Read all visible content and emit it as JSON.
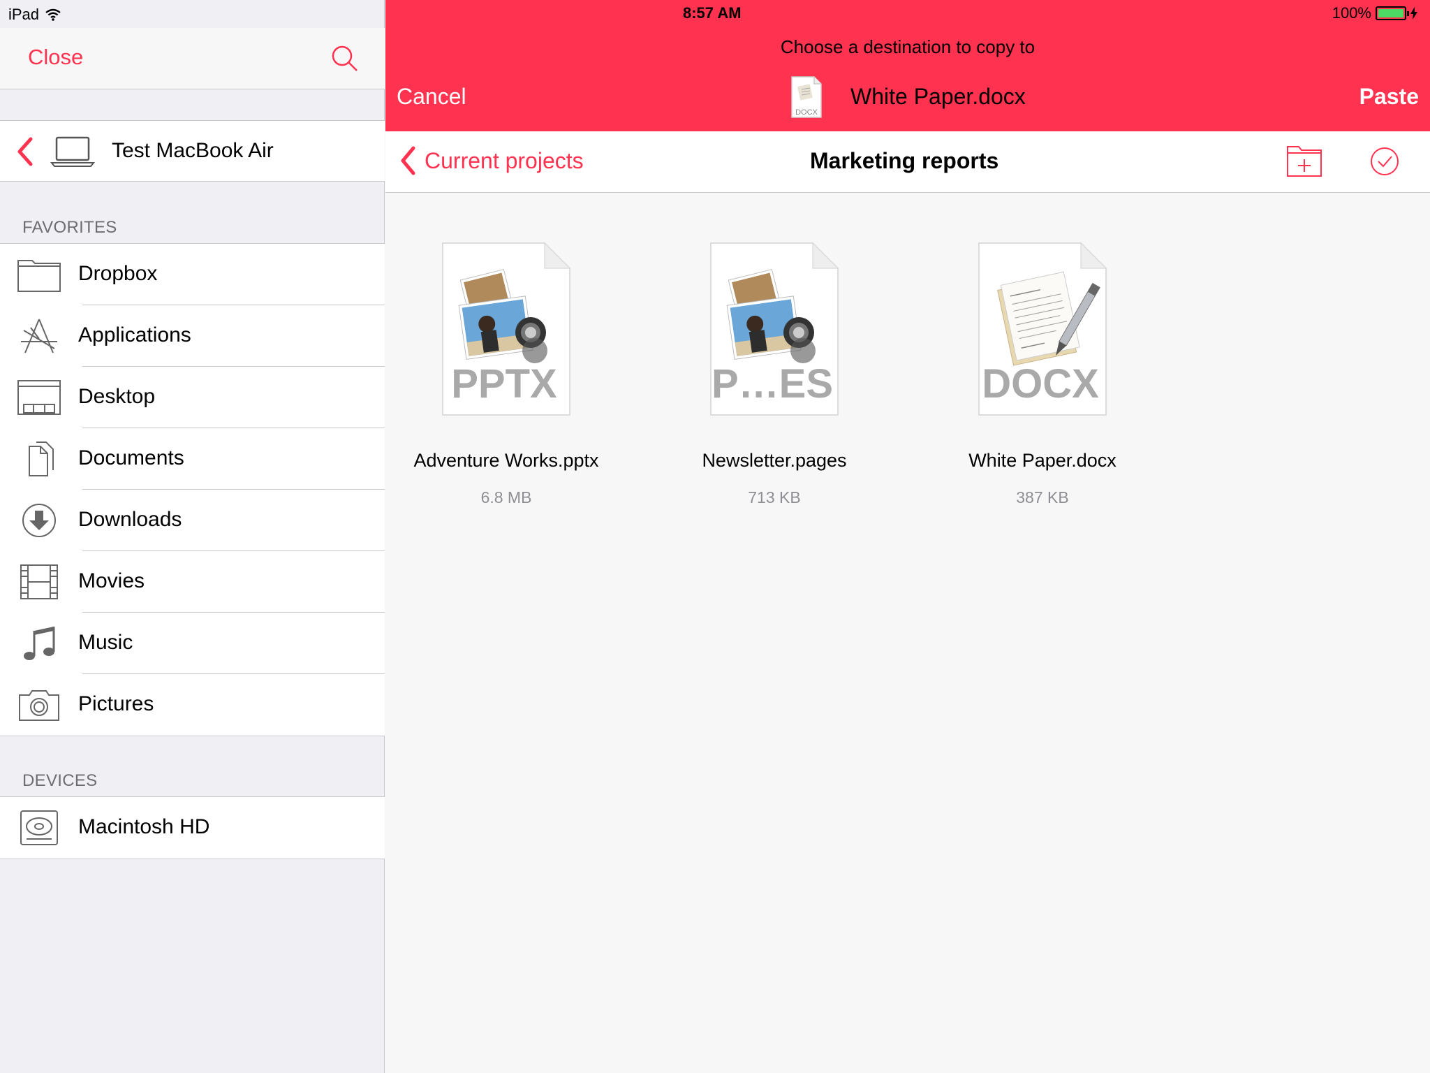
{
  "status": {
    "carrier": "iPad",
    "time": "8:57 AM",
    "battery": "100%"
  },
  "sidebar": {
    "close_label": "Close",
    "device_name": "Test MacBook Air",
    "favorites_header": "FAVORITES",
    "favorites": [
      {
        "label": "Dropbox",
        "icon": "folder-icon"
      },
      {
        "label": "Applications",
        "icon": "applications-icon"
      },
      {
        "label": "Desktop",
        "icon": "desktop-icon"
      },
      {
        "label": "Documents",
        "icon": "documents-icon"
      },
      {
        "label": "Downloads",
        "icon": "download-icon"
      },
      {
        "label": "Movies",
        "icon": "film-icon"
      },
      {
        "label": "Music",
        "icon": "music-note-icon"
      },
      {
        "label": "Pictures",
        "icon": "camera-icon"
      }
    ],
    "devices_header": "DEVICES",
    "devices": [
      {
        "label": "Macintosh HD",
        "icon": "hard-drive-icon"
      }
    ]
  },
  "copy_bar": {
    "prompt": "Choose a destination to copy to",
    "cancel_label": "Cancel",
    "paste_label": "Paste",
    "file_name": "White Paper.docx",
    "file_badge": "DOCX"
  },
  "nav": {
    "back_label": "Current projects",
    "title": "Marketing reports"
  },
  "files": [
    {
      "name": "Adventure Works.pptx",
      "size": "6.8 MB",
      "ext": "PPTX"
    },
    {
      "name": "Newsletter.pages",
      "size": "713 KB",
      "ext": "P…ES"
    },
    {
      "name": "White Paper.docx",
      "size": "387 KB",
      "ext": "DOCX"
    }
  ],
  "colors": {
    "accent": "#ff3250",
    "separator": "#c8c7cc",
    "sidebar_bg": "#efeff4"
  }
}
